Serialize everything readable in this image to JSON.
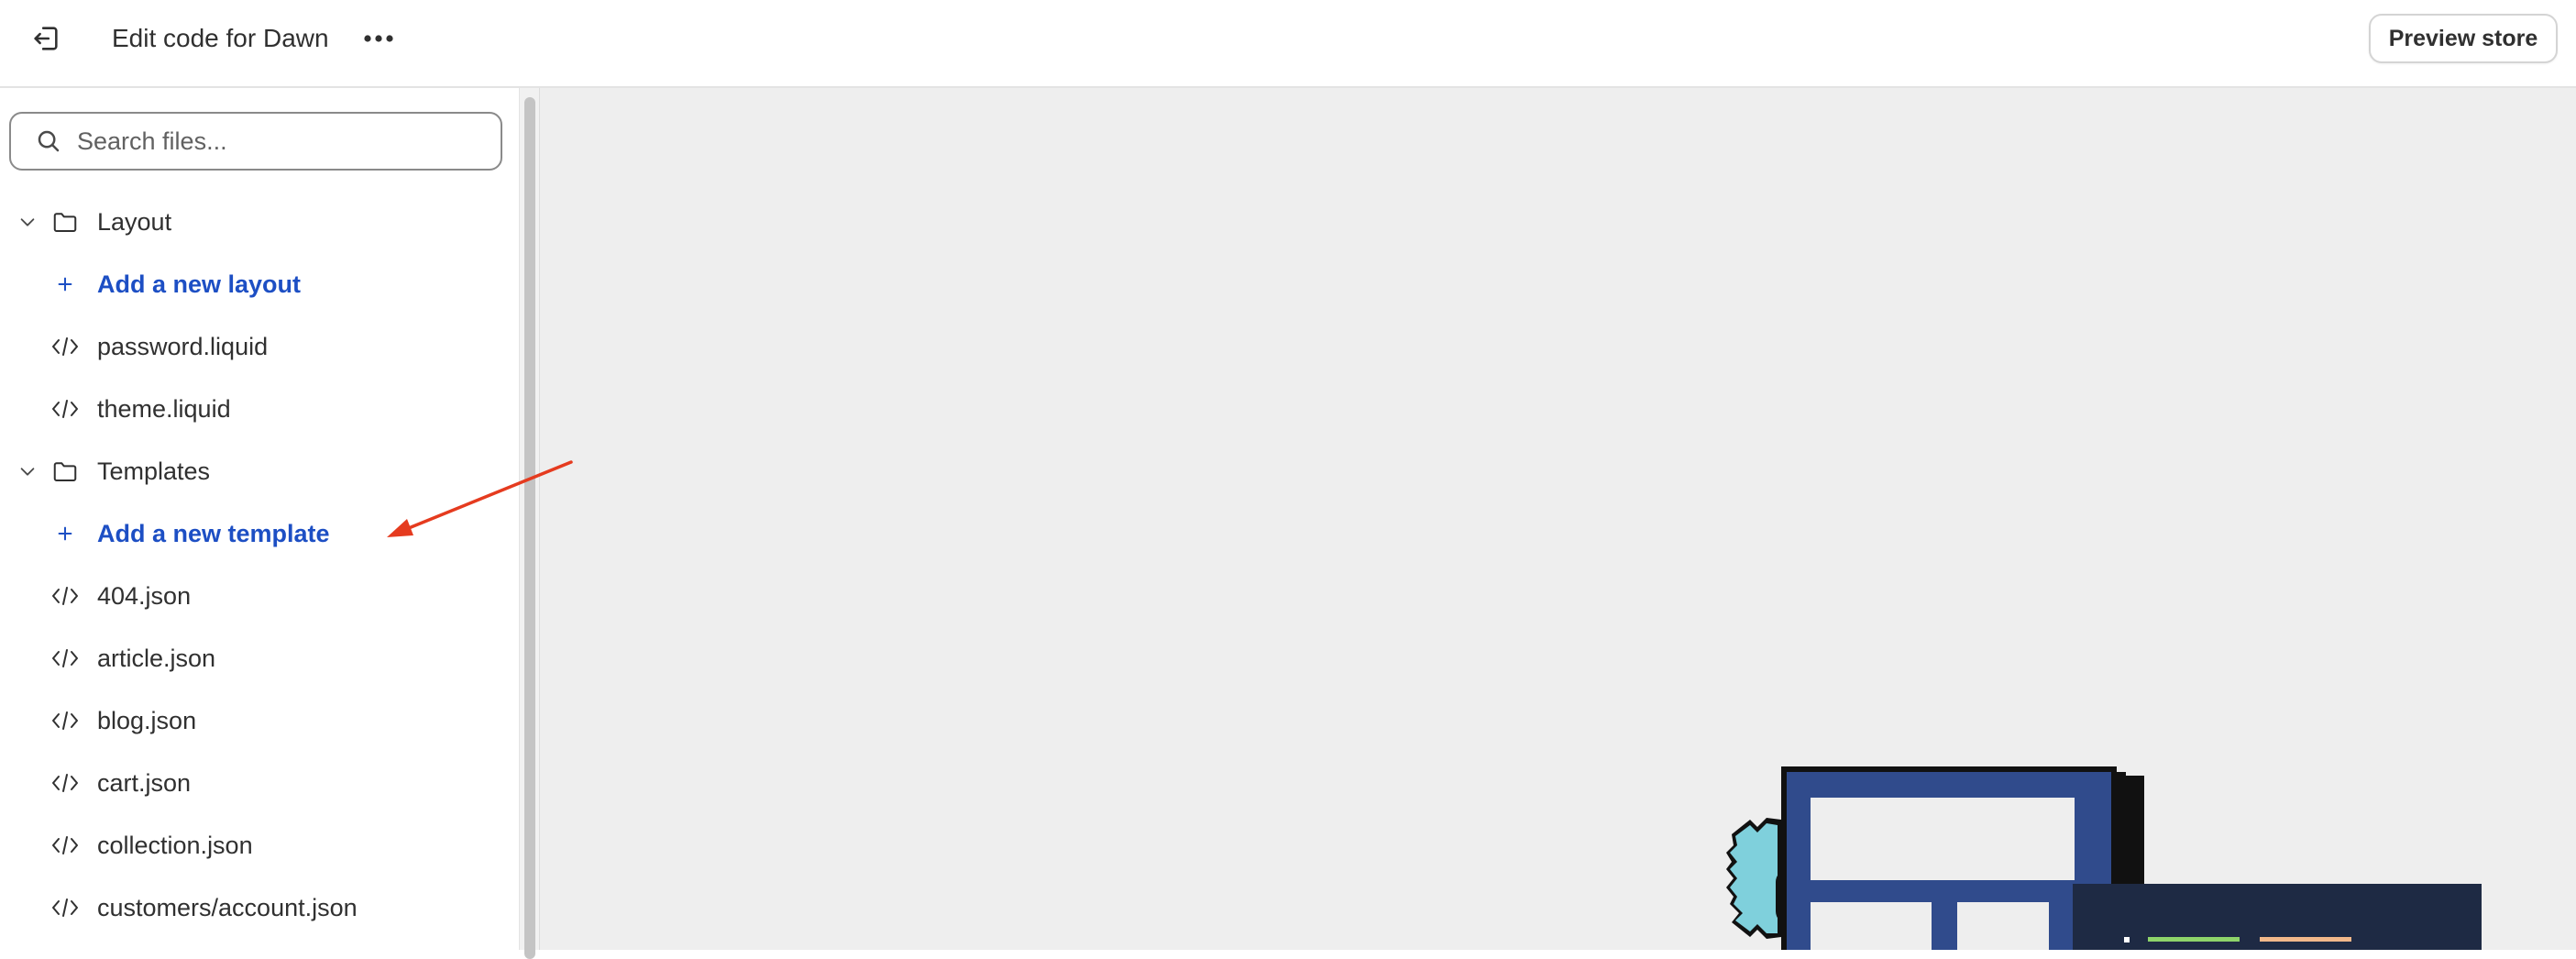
{
  "header": {
    "title": "Edit code for Dawn",
    "preview_label": "Preview store"
  },
  "search": {
    "placeholder": "Search files..."
  },
  "tree": {
    "layout_folder": "Layout",
    "add_layout": "Add a new layout",
    "layout_files": [
      "password.liquid",
      "theme.liquid"
    ],
    "templates_folder": "Templates",
    "add_template": "Add a new template",
    "template_files": [
      "404.json",
      "article.json",
      "blog.json",
      "cart.json",
      "collection.json",
      "customers/account.json"
    ]
  },
  "colors": {
    "link_blue": "#1d4fc4",
    "annotation_arrow": "#e53b1f",
    "editor_bg": "#eeeeee",
    "code_panel": "#1e2a44"
  }
}
